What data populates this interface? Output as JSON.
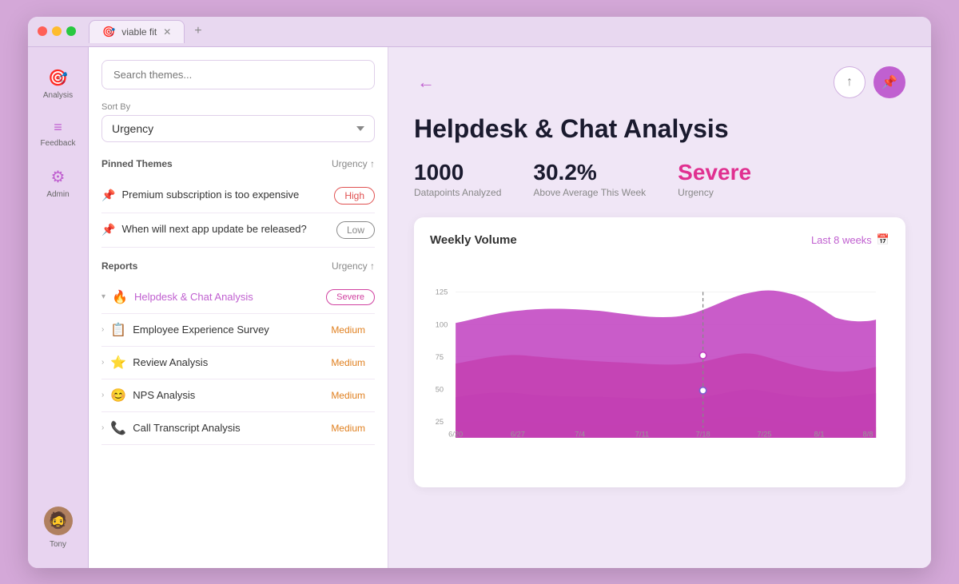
{
  "window": {
    "tab_title": "viable fit",
    "tab_icon": "🎯"
  },
  "sidebar": {
    "items": [
      {
        "id": "analysis",
        "icon": "🎯",
        "label": "Analysis"
      },
      {
        "id": "feedback",
        "icon": "≡",
        "label": "Feedback"
      },
      {
        "id": "admin",
        "icon": "⚙",
        "label": "Admin"
      }
    ],
    "user": {
      "name": "Tony",
      "avatar_emoji": "👤"
    }
  },
  "panel": {
    "search_placeholder": "Search themes...",
    "sort_label": "Sort By",
    "sort_value": "Urgency",
    "pinned_section_title": "Pinned Themes",
    "pinned_section_sort": "Urgency ↑",
    "pinned_items": [
      {
        "id": 1,
        "text": "Premium subscription is too expensive",
        "badge": "High",
        "badge_type": "high"
      },
      {
        "id": 2,
        "text": "When will next app update be released?",
        "badge": "Low",
        "badge_type": "low"
      }
    ],
    "reports_section_title": "Reports",
    "reports_section_sort": "Urgency ↑",
    "report_items": [
      {
        "id": 1,
        "text": "Helpdesk & Chat Analysis",
        "icon": "🔥",
        "badge": "Severe",
        "badge_type": "severe",
        "active": true,
        "expanded": true
      },
      {
        "id": 2,
        "text": "Employee Experience Survey",
        "icon": "📋",
        "badge": "Medium",
        "badge_type": "medium",
        "active": false,
        "expanded": false
      },
      {
        "id": 3,
        "text": "Review Analysis",
        "icon": "⭐",
        "badge": "Medium",
        "badge_type": "medium",
        "active": false,
        "expanded": false
      },
      {
        "id": 4,
        "text": "NPS Analysis",
        "icon": "😊",
        "badge": "Medium",
        "badge_type": "medium",
        "active": false,
        "expanded": false
      },
      {
        "id": 5,
        "text": "Call Transcript Analysis",
        "icon": "📞",
        "badge": "Medium",
        "badge_type": "medium",
        "active": false,
        "expanded": false
      }
    ]
  },
  "main": {
    "title": "Helpdesk & Chat Analysis",
    "stats": [
      {
        "id": "datapoints",
        "value": "1000",
        "label": "Datapoints Analyzed",
        "severe": false
      },
      {
        "id": "above_avg",
        "value": "30.2%",
        "label": "Above Average This Week",
        "severe": false
      },
      {
        "id": "urgency",
        "value": "Severe",
        "label": "Urgency",
        "severe": true
      }
    ],
    "chart": {
      "title": "Weekly Volume",
      "range_label": "Last 8 weeks",
      "x_labels": [
        "6/20",
        "6/27",
        "7/4",
        "7/11",
        "7/18",
        "7/25",
        "8/1",
        "8/8"
      ],
      "y_labels": [
        "125",
        "100",
        "75",
        "50",
        "25"
      ],
      "marker_x": "7/18"
    }
  }
}
